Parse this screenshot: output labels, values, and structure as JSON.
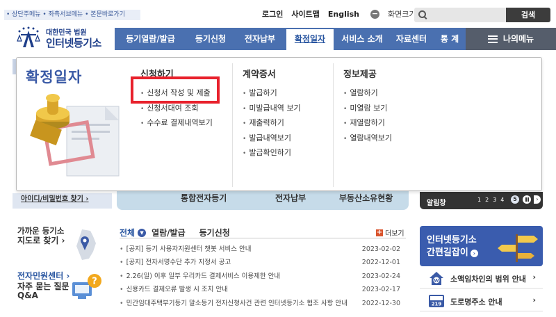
{
  "skip_links": "• 상단주메뉴 • 좌측서브메뉴 • 본문바로가기",
  "util": {
    "login": "로그인",
    "sitemap": "사이트맵",
    "english": "English",
    "zoom_label": "화면크기",
    "zoom_out": "−",
    "zoom_in": "+"
  },
  "search": {
    "placeholder": "",
    "button": "검색"
  },
  "logo": {
    "line1": "대한민국 법원",
    "line2": "인터넷등기소"
  },
  "nav": {
    "items": [
      "등기열람/발급",
      "등기신청",
      "전자납부",
      "확정일자",
      "서비스 소개",
      "자료센터",
      "통 계"
    ],
    "active_index": 3,
    "my_menu": "나의메뉴"
  },
  "dropdown": {
    "title": "확정일자",
    "columns": [
      {
        "heading": "신청하기",
        "items": [
          "신청서 작성 및 제출",
          "신청서대여 조회",
          "수수료 결제내역보기"
        ]
      },
      {
        "heading": "계약증서",
        "items": [
          "발급하기",
          "미발급내역 보기",
          "재출력하기",
          "발급내역보기",
          "발급확인하기"
        ]
      },
      {
        "heading": "정보제공",
        "items": [
          "열람하기",
          "미열람 보기",
          "재열람하기",
          "열람내역보기"
        ]
      }
    ]
  },
  "background": {
    "login_find": "아이디/비밀번호 찾기",
    "services": [
      "통합전자등기",
      "전자납부",
      "부동산소유현황"
    ],
    "notice_label": "알림창",
    "pages": [
      "1",
      "2",
      "3",
      "4"
    ],
    "current_page": "5"
  },
  "left_quick": {
    "nearest_title": "가까운 등기소",
    "nearest_sub": "지도로 찾기 ›",
    "minwon": "전자민원센터 ›",
    "faq_line1": "자주 묻는 질문",
    "faq_line2": "Q&A"
  },
  "board": {
    "tabs": [
      "전체",
      "열람/발급",
      "등기신청"
    ],
    "more": "더보기",
    "notices": [
      {
        "title": "[공지] 등기 사용자지원센터 챗봇 서비스 안내",
        "date": "2023-02-02"
      },
      {
        "title": "[공지] 전자서명수단 추가 지정서 공고",
        "date": "2022-12-01"
      },
      {
        "title": "2.26(일) 이후 일부 우리카드 결제서비스 이용제한 안내",
        "date": "2023-02-24"
      },
      {
        "title": "신용카드 결제오류 발생 시 조치 안내",
        "date": "2023-02-17"
      },
      {
        "title": "민간임대주택부기등기 말소등기 전자신청사건 관련 인터넷등기소 협조 사항 안내",
        "date": "2022-12-30"
      }
    ]
  },
  "right_links": {
    "guide_line1": "인터넷등기소",
    "guide_line2": "간편길잡이",
    "small_claim": "소액임차인의 범위 안내",
    "road_address": "도로명주소 안내",
    "road_badge": "219"
  },
  "colors": {
    "nav": "#4a70b0",
    "accent": "#3a5aa6",
    "highlight": "#e8212c"
  }
}
